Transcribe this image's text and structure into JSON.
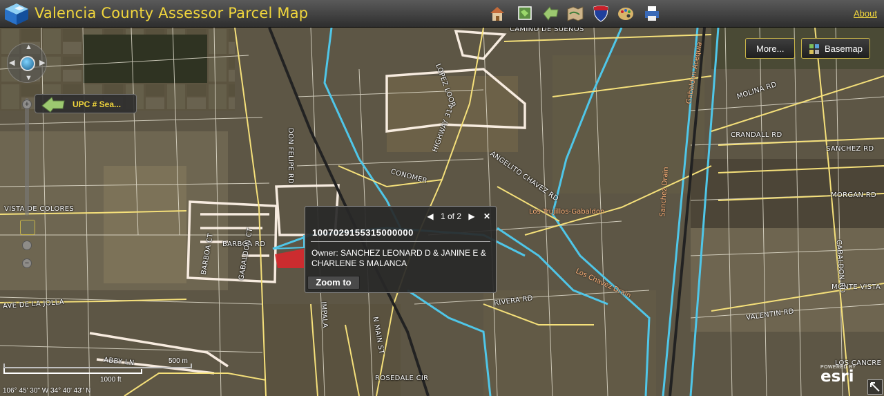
{
  "header": {
    "title": "Valencia County Assessor Parcel Map",
    "about": "About",
    "tools": [
      {
        "icon": "home-icon"
      },
      {
        "icon": "layers-icon"
      },
      {
        "icon": "upc-search-icon"
      },
      {
        "icon": "legend-map-icon"
      },
      {
        "icon": "interstate-shield-icon"
      },
      {
        "icon": "palette-icon"
      },
      {
        "icon": "print-icon"
      }
    ],
    "accent": "#f1d63c"
  },
  "controls": {
    "more": "More...",
    "basemap": "Basemap",
    "upc_search": "UPC # Sea..."
  },
  "popup": {
    "pager": "1 of 2",
    "parcel_id": "1007029155315000000",
    "owner": "Owner: SANCHEZ LEONARD D & JANINE E & CHARLENE S MALANCA",
    "zoom_to": "Zoom to"
  },
  "roads": {
    "r1": "CAMINO DE SUENOS",
    "r2": "MOLINA RD",
    "r3": "CRANDALL RD",
    "r4": "SANCHEZ RD",
    "r5": "MORGAN RD",
    "r6": "MONTE VISTA",
    "r7": "VALENTIN RD",
    "r8": "LOS CANCRE",
    "r9": "VISTA DE COLORES",
    "r10": "AVE DE LA JOLLA",
    "r11": "ABBY LN",
    "r12": "ROSEDALE CIR",
    "r13": "N MAIN ST",
    "r14": "RIVERA RD",
    "r15": "CONOMER",
    "r16": "ANGELITO CHAVEZ RD",
    "r17": "HIGHWAY 314",
    "r18": "LOPEZ LOOP",
    "r19": "DON FELIPE RD",
    "r20": "BARBOA RD",
    "r21": "BARBOA CT",
    "r22": "GABALDON CT",
    "r23": "IMPALA",
    "r24": "CABALDON RD"
  },
  "places": {
    "p1": "Los Trujillos-Gabaldon",
    "p2": "Sanchez Drain",
    "p3": "Gabaldon Acequia",
    "p4": "Los Chavez Drain"
  },
  "scale": {
    "m": "500 m",
    "ft": "1000 ft"
  },
  "coords": "106° 45' 30\" W 34° 40' 43\" N",
  "attribution": {
    "powered": "POWERED BY",
    "logo": "esri"
  },
  "colors": {
    "parcel": "#ffffff",
    "road": "#f5e07a",
    "drain": "#4fc6e8",
    "selected": "#d8282c"
  }
}
